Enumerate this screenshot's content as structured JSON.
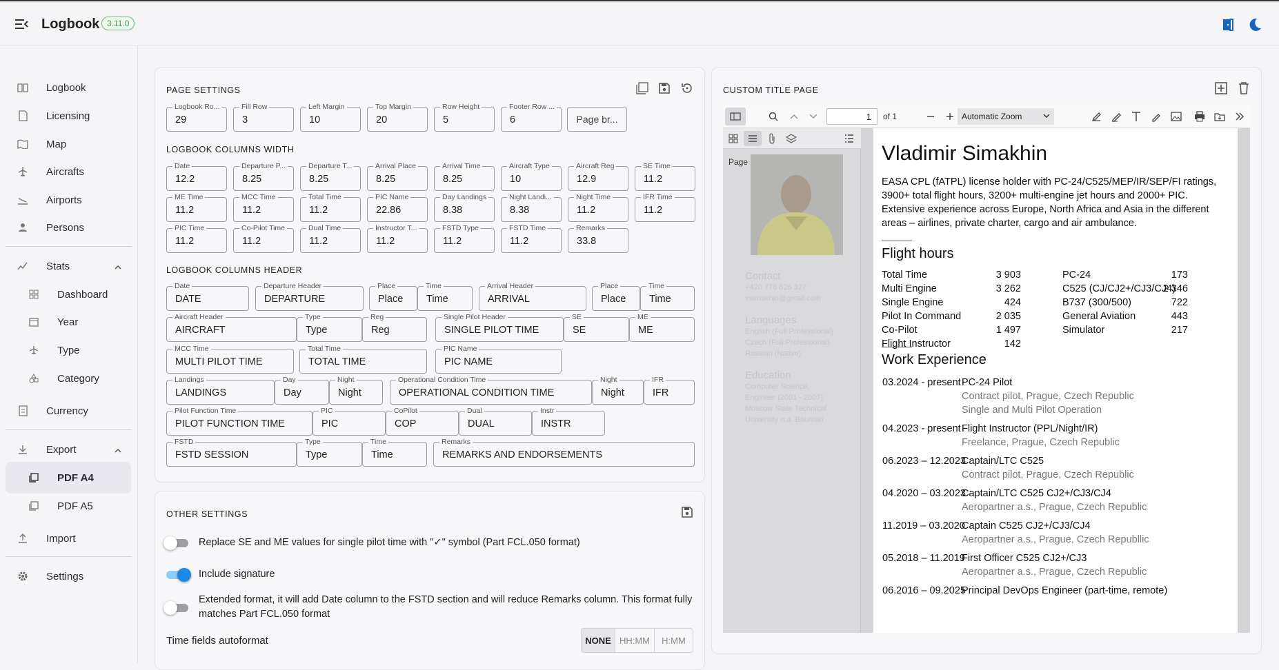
{
  "app": {
    "title": "Logbook",
    "version": "3.11.0"
  },
  "sidebar": {
    "items": [
      {
        "label": "Logbook",
        "icon": "book-open-icon"
      },
      {
        "label": "Licensing",
        "icon": "document-icon"
      },
      {
        "label": "Map",
        "icon": "map-icon"
      },
      {
        "label": "Aircrafts",
        "icon": "airplane-icon"
      },
      {
        "label": "Airports",
        "icon": "airplane-landing-icon"
      },
      {
        "label": "Persons",
        "icon": "person-icon"
      }
    ],
    "stats": {
      "label": "Stats",
      "children": [
        "Dashboard",
        "Year",
        "Type",
        "Category"
      ]
    },
    "currency": "Currency",
    "export": {
      "label": "Export",
      "children": [
        "PDF A4",
        "PDF A5"
      ],
      "active": "PDF A4"
    },
    "import": "Import",
    "settings": "Settings"
  },
  "page_settings": {
    "title": "PAGE SETTINGS",
    "fields": [
      {
        "label": "Logbook Ro...",
        "value": "29"
      },
      {
        "label": "Fill Row",
        "value": "3"
      },
      {
        "label": "Left Margin",
        "value": "10"
      },
      {
        "label": "Top Margin",
        "value": "20"
      },
      {
        "label": "Row Height",
        "value": "5"
      },
      {
        "label": "Footer Row ...",
        "value": "6"
      }
    ],
    "page_break_button": "Page br...",
    "widths_title": "LOGBOOK COLUMNS WIDTH",
    "widths": [
      [
        {
          "label": "Date",
          "value": "12.2"
        },
        {
          "label": "Departure P...",
          "value": "8.25"
        },
        {
          "label": "Departure T...",
          "value": "8.25"
        },
        {
          "label": "Arrival Place",
          "value": "8.25"
        },
        {
          "label": "Arrival Time",
          "value": "8.25"
        },
        {
          "label": "Aircraft Type",
          "value": "10"
        },
        {
          "label": "Aircraft Reg",
          "value": "12.9"
        },
        {
          "label": "SE Time",
          "value": "11.2"
        }
      ],
      [
        {
          "label": "ME Time",
          "value": "11.2"
        },
        {
          "label": "MCC Time",
          "value": "11.2"
        },
        {
          "label": "Total Time",
          "value": "11.2"
        },
        {
          "label": "PIC Name",
          "value": "22.86"
        },
        {
          "label": "Day Landings",
          "value": "8.38"
        },
        {
          "label": "Night Landi...",
          "value": "8.38"
        },
        {
          "label": "Night Time",
          "value": "11.2"
        },
        {
          "label": "IFR Time",
          "value": "11.2"
        }
      ],
      [
        {
          "label": "PIC Time",
          "value": "11.2"
        },
        {
          "label": "Co-Pilot Time",
          "value": "11.2"
        },
        {
          "label": "Dual Time",
          "value": "11.2"
        },
        {
          "label": "Instructor T...",
          "value": "11.2"
        },
        {
          "label": "FSTD Type",
          "value": "11.2"
        },
        {
          "label": "FSTD Time",
          "value": "11.2"
        },
        {
          "label": "Remarks",
          "value": "33.8"
        }
      ]
    ],
    "headers_title": "LOGBOOK COLUMNS HEADER",
    "headers": {
      "r1": [
        {
          "label": "Date",
          "value": "DATE"
        },
        {
          "label": "Departure Header",
          "value": "DEPARTURE"
        },
        {
          "label": "Place",
          "value": "Place"
        },
        {
          "label": "Time",
          "value": "Time"
        },
        {
          "label": "Arrival Header",
          "value": "ARRIVAL"
        },
        {
          "label": "Place",
          "value": "Place"
        },
        {
          "label": "Time",
          "value": "Time"
        }
      ],
      "r2": [
        {
          "label": "Aircraft Header",
          "value": "AIRCRAFT"
        },
        {
          "label": "Type",
          "value": "Type"
        },
        {
          "label": "Reg",
          "value": "Reg"
        },
        {
          "label": "Single Pilot Header",
          "value": "SINGLE PILOT TIME"
        },
        {
          "label": "SE",
          "value": "SE"
        },
        {
          "label": "ME",
          "value": "ME"
        }
      ],
      "r3": [
        {
          "label": "MCC Time",
          "value": "MULTI PILOT TIME"
        },
        {
          "label": "Total Time",
          "value": "TOTAL TIME"
        },
        {
          "label": "PIC Name",
          "value": "PIC NAME"
        }
      ],
      "r4": [
        {
          "label": "Landings",
          "value": "LANDINGS"
        },
        {
          "label": "Day",
          "value": "Day"
        },
        {
          "label": "Night",
          "value": "Night"
        },
        {
          "label": "Operational Condition Time",
          "value": "OPERATIONAL CONDITION TIME"
        },
        {
          "label": "Night",
          "value": "Night"
        },
        {
          "label": "IFR",
          "value": "IFR"
        }
      ],
      "r5": [
        {
          "label": "Pilot Function Time",
          "value": "PILOT FUNCTION TIME"
        },
        {
          "label": "PIC",
          "value": "PIC"
        },
        {
          "label": "CoPilot",
          "value": "COP"
        },
        {
          "label": "Dual",
          "value": "DUAL"
        },
        {
          "label": "Instr",
          "value": "INSTR"
        }
      ],
      "r6": [
        {
          "label": "FSTD",
          "value": "FSTD SESSION"
        },
        {
          "label": "Type",
          "value": "Type"
        },
        {
          "label": "Time",
          "value": "Time"
        },
        {
          "label": "Remarks",
          "value": "REMARKS AND ENDORSEMENTS"
        }
      ]
    }
  },
  "other_settings": {
    "title": "OTHER SETTINGS",
    "toggles": [
      {
        "label": "Replace SE and ME values for single pilot time with \"✓\" symbol (Part FCL.050 format)",
        "on": false
      },
      {
        "label": "Include signature",
        "on": true
      },
      {
        "label": "Extended format, it will add Date column to the FSTD section and will reduce Remarks column. This format fully",
        "label2": "matches Part FCL.050 format",
        "on": false
      }
    ],
    "autoformat_label": "Time fields autoformat",
    "autoformat_options": [
      "NONE",
      "HH:MM",
      "H:MM"
    ],
    "autoformat_selected": "NONE"
  },
  "title_page": {
    "title": "CUSTOM TITLE PAGE",
    "viewer": {
      "page_number": "1",
      "page_count": "of 1",
      "zoom": "Automatic Zoom",
      "thumb_label": "Page 1"
    },
    "thumb": {
      "contact_h": "Contact",
      "contact_1": "+420 776 626 327",
      "contact_2": "vsimakhin@gmail.com",
      "lang_h": "Languages",
      "lang_1": "English (Full Professional)",
      "lang_2": "Czech (Full Professional)",
      "lang_3": "Russian (Native)",
      "edu_h": "Education",
      "edu_1": "Computer Science,",
      "edu_2": "Engineer (2001 - 2007)",
      "edu_3": "Moscow State Technical",
      "edu_4": "University n.a. Bauman"
    },
    "doc": {
      "name": "Vladimir Simakhin",
      "intro": [
        "EASA CPL (fATPL) license holder with PC-24/C525/MEP/IR/SEP/FI ratings,",
        "3900+ total flight hours, 3200+ multi-engine jet hours and 2000+ PIC.",
        "Extensive experience across Europe, North Africa and Asia in the different",
        "areas – airlines, private charter, cargo and air ambulance."
      ],
      "flight_hours_h": "Flight hours",
      "flight_hours_left": [
        [
          "Total Time",
          "3 903"
        ],
        [
          "Multi Engine",
          "3 262"
        ],
        [
          "Single Engine",
          "424"
        ],
        [
          "Pilot In Command",
          "2 035"
        ],
        [
          "Co-Pilot",
          "1 497"
        ],
        [
          "Flight Instructor",
          "142"
        ]
      ],
      "flight_hours_right": [
        [
          "PC-24",
          "173"
        ],
        [
          "C525 (CJ/CJ2+/CJ3/CJ4)",
          "2 346"
        ],
        [
          "B737 (300/500)",
          "722"
        ],
        [
          "General Aviation",
          "443"
        ],
        [
          "Simulator",
          "217"
        ]
      ],
      "work_h": "Work Experience",
      "work": [
        {
          "date": "03.2024 - present",
          "title": "PC-24 Pilot",
          "sub": [
            "Contract pilot, Prague, Czech Republic",
            "Single and Multi Pilot Operation"
          ]
        },
        {
          "date": "04.2023 - present",
          "title": "Flight Instructor (PPL/Night/IR)",
          "sub": [
            "Freelance, Prague, Czech Republic"
          ]
        },
        {
          "date": "06.2023 – 12.2023",
          "title": "Captain/LTC C525",
          "sub": [
            "Contract pilot, Prague, Czech Republic"
          ]
        },
        {
          "date": "04.2020 – 03.2023",
          "title": "Captain/LTC C525 CJ2+/CJ3/CJ4",
          "sub": [
            "Aeropartner a.s., Prague, Czech Republic"
          ]
        },
        {
          "date": "11.2019 – 03.2020",
          "title": "Captain C525 CJ2+/CJ3/CJ4",
          "sub": [
            "Aeropartner a.s., Prague, Czech Republlic"
          ]
        },
        {
          "date": "05.2018 – 11.2019",
          "title": "First Officer C525 CJ2+/CJ3",
          "sub": [
            "Aeropartner a.s., Prague, Czech Republic"
          ]
        },
        {
          "date": "06.2016 – 09.2025",
          "title": "Principal DevOps Engineer (part-time, remote)",
          "sub": []
        }
      ]
    }
  },
  "colors": {
    "accent": "#1e88e5",
    "version_badge": "#43a047",
    "header_icons": "#1565c0"
  }
}
